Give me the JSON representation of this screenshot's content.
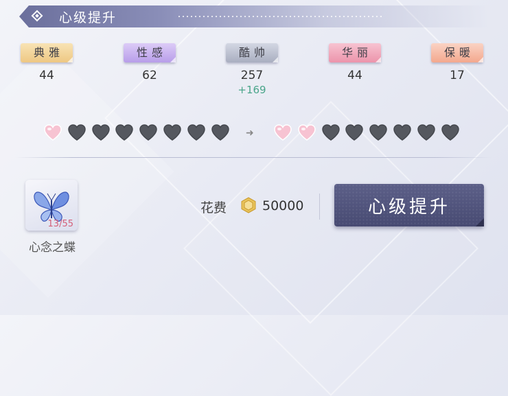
{
  "header": {
    "title": "心级提升"
  },
  "stats": [
    {
      "label": "典雅",
      "value": "44",
      "bonus": "",
      "color": "#f3d79a"
    },
    {
      "label": "性感",
      "value": "62",
      "bonus": "",
      "color": "#c9b2f0"
    },
    {
      "label": "酷帅",
      "value": "257",
      "bonus": "+169",
      "color": "#bfc4d3"
    },
    {
      "label": "华丽",
      "value": "44",
      "bonus": "",
      "color": "#f2a9bd"
    },
    {
      "label": "保暖",
      "value": "17",
      "bonus": "",
      "color": "#f6bda7"
    }
  ],
  "hearts": {
    "before": {
      "filled": 1,
      "total": 8
    },
    "after": {
      "filled": 2,
      "total": 8
    },
    "filled_color": "#f7c3d2",
    "empty_color": "#55585f"
  },
  "item": {
    "name": "心念之蝶",
    "count": "13/55",
    "icon": "butterfly-icon"
  },
  "cost": {
    "label": "花费",
    "value": "50000",
    "icon": "coin-icon"
  },
  "upgrade_button": {
    "label": "心级提升"
  }
}
